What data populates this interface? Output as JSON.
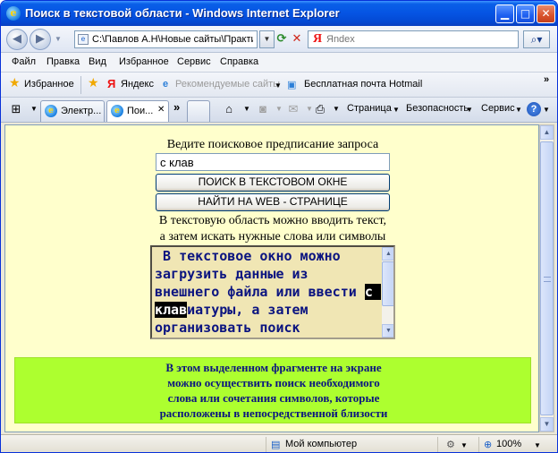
{
  "window": {
    "title": "Поиск в текстовой области - Windows Internet Explorer",
    "ie_logo": "e"
  },
  "address_bar": {
    "url": "C:\\Павлов А.Н\\Новые сайты\\Практи",
    "search_placeholder": "Яndex",
    "search_logo": "Я"
  },
  "menu": {
    "items": [
      "Файл",
      "Правка",
      "Вид",
      "Избранное",
      "Сервис",
      "Справка"
    ]
  },
  "favorites_bar": {
    "favorites": "Избранное",
    "yandex": "Яндекс",
    "yandex_logo": "Я",
    "suggested": "Рекомендуемые сайты",
    "hotmail": "Бесплатная почта Hotmail"
  },
  "tabs": [
    {
      "label": "Электр..."
    },
    {
      "label": "Пои..."
    }
  ],
  "command_bar": {
    "page": "Страница",
    "safety": "Безопасность",
    "tools": "Сервис"
  },
  "page": {
    "prompt": "Ведите поисковое предписание запроса",
    "query_value": "с клав",
    "btn_search_textarea": "ПОИСК В ТЕКСТОВОМ ОКНЕ",
    "btn_search_web": "НАЙТИ НА WEB - СТРАНИЦЕ",
    "hint_line1": "В текстовую область можно вводить текст,",
    "hint_line2": "а затем искать нужные слова или символы",
    "textarea": {
      "before": " В текстовое окно можно загрузить данные из внешнего файла или ввести ",
      "selected": "с клав",
      "after": "иатуры, а затем организовать поиск"
    },
    "green_lines": [
      "В этом выделенном фрагменте на экране",
      "можно осуществить поиск необходимого",
      "слова или сочетания символов, которые",
      "расположены в непосредственной близости"
    ]
  },
  "status_bar": {
    "zone": "Мой компьютер",
    "zoom": "100%"
  }
}
